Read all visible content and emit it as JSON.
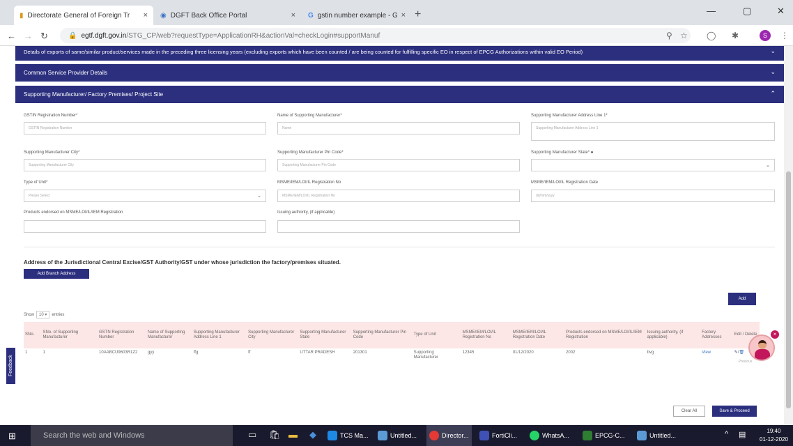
{
  "browser": {
    "tabs": [
      {
        "title": "Directorate General of Foreign Tr",
        "close": "×"
      },
      {
        "title": "DGFT Back Office Portal",
        "close": "×"
      },
      {
        "title": "gstin number example - Google",
        "close": "×"
      }
    ],
    "new_tab": "+",
    "window": {
      "minimize": "—",
      "maximize": "▢",
      "close": "✕"
    },
    "url_domain": "egtf.dgft.gov.in",
    "url_path": "/STG_CP/web?requestType=ApplicationRH&actionVal=checkLogin#supportManuf",
    "profile_initial": "S"
  },
  "accordions": {
    "exports": "Details of exports of same/similar product/services made in the preceding three licensing years (excluding exports which have been counted / are being counted for fulfilling specific EO in respect of EPCG Authorizations within valid EO Period)",
    "csp": "Common Service Provider Details",
    "support": "Supporting Manufacturer/ Factory Premises/ Project Site",
    "chev_down": "⌄",
    "chev_up": "⌃"
  },
  "form": {
    "gstin_label": "GSTIN Registration Number*",
    "gstin_ph": "GSTIN Registration Number",
    "name_label": "Name of Supporting Manufacturer*",
    "name_ph": "Name",
    "addr1_label": "Supporting Manufacturer Address Line 1*",
    "addr1_ph": "Supporting Manufacturer Address Line 1",
    "city_label": "Supporting Manufacturer City*",
    "city_ph": "Supporting Manufacturer City",
    "pin_label": "Supporting Manufacturer Pin Code*",
    "pin_ph": "Supporting Manufacturer Pin Code",
    "state_label": "Supporting Manufacturer State*",
    "unit_label": "Type of Unit*",
    "unit_value": "Please Select",
    "msme_no_label": "MSME/IEM/LOI/IL Registration No",
    "msme_no_ph": "MSME/IEM/LOI/IL Registration No",
    "msme_date_label": "MSME/IEM/LOI/IL Registration Date",
    "msme_date_ph": "dd/mm/yyyy",
    "products_label": "Products endorsed on MSME/LOI/IL/IEM Registration",
    "issuing_label": "Issuing authority, (if applicable)"
  },
  "jurisdiction_title": "Address of the Jurisdictional Central Excise/GST Authority/GST under whose jurisdiction the factory/premises situated.",
  "add_branch_btn": "Add Branch Address",
  "add_btn": "Add",
  "show": {
    "prefix": "Show",
    "value": "10",
    "suffix": "entries"
  },
  "table": {
    "headers": [
      "SNo.",
      "SNo. of Supporting Manufacturer",
      "GSTN Registration Number",
      "Name of Supporting Manufacturer",
      "Supporting Manufacturer Address Line 1",
      "Supporting Manufacturer City",
      "Supporting Manufacturer State",
      "Supporting Manufacturer Pin Code",
      "Type of Unit",
      "MSME/IEM/LOI/IL Registration No",
      "MSME/IEM/LOI/IL Registration Date",
      "Products endorsed on MSME/LOI/IL/IEM Registration",
      "Issuing authority, (if applicable)",
      "Factory Addresses",
      "Edit / Delete"
    ],
    "row": [
      "1",
      "1",
      "10AABCU9603R1Z2",
      "gyy",
      "ffg",
      "ff",
      "UTTAR PRADESH",
      "201301",
      "Supporting Manufacturer",
      "12345",
      "01/12/2020",
      "2002",
      "bvg",
      "View"
    ]
  },
  "previous": "Previous",
  "feedback": "Feedback",
  "clear_all": "Clear All",
  "save_proceed": "Save & Proceed",
  "taskbar": {
    "search": "Search the web and Windows",
    "apps": [
      "TCS Ma...",
      "Untitled...",
      "Director...",
      "FortiCli...",
      "WhatsA...",
      "EPCG-C...",
      "Untitled..."
    ],
    "time": "19:40",
    "date": "01-12-2020"
  }
}
